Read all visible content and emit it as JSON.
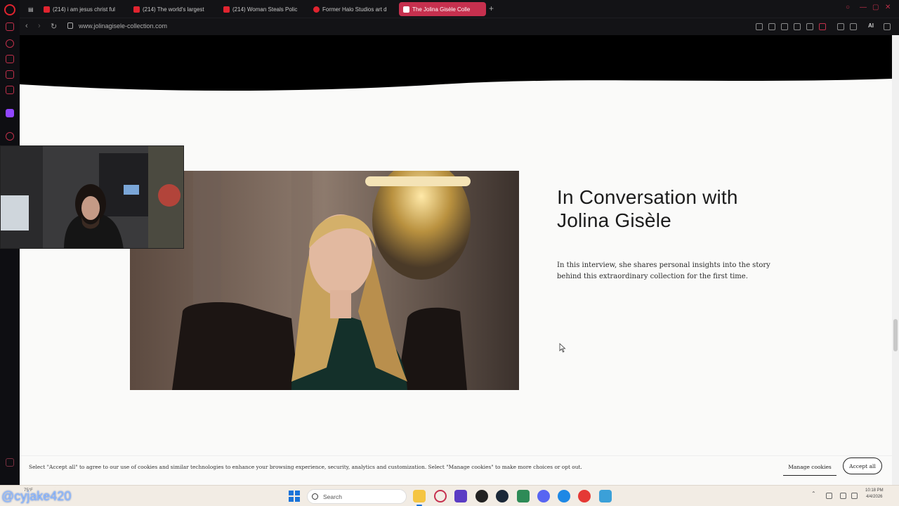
{
  "browser": {
    "tabs": [
      {
        "label": "(214) i am jesus christ ful"
      },
      {
        "label": "(214) The world's largest"
      },
      {
        "label": "(214) Woman Steals Polic"
      },
      {
        "label": "Former Halo Studios art d"
      },
      {
        "label": "The Jolina Gisèle Colle"
      }
    ],
    "new_tab": "+",
    "url": "www.jolinagisele-collection.com",
    "ai_label": "AI"
  },
  "page": {
    "interview_title_line1": "In Conversation with",
    "interview_title_line2": "Jolina Gisèle",
    "interview_text": "In this interview, she shares personal insights into the story behind this extraordinary collection for the first time."
  },
  "cookie_banner": {
    "text": "Select \"Accept all\" to agree to our use of cookies and similar technologies to enhance your browsing experience, security, analytics and customization. Select \"Manage cookies\" to make more choices or opt out.",
    "manage_label": "Manage cookies",
    "accept_label": "Accept all"
  },
  "taskbar": {
    "weather": "75°F",
    "search_placeholder": "Search",
    "time": "10:18 PM",
    "date": "4/4/2026"
  },
  "stream_overlay": {
    "handle": "@cyjake420"
  },
  "colors": {
    "accent": "#c6304e",
    "opera_red": "#e0242f",
    "page_bg": "#fafaf9"
  }
}
